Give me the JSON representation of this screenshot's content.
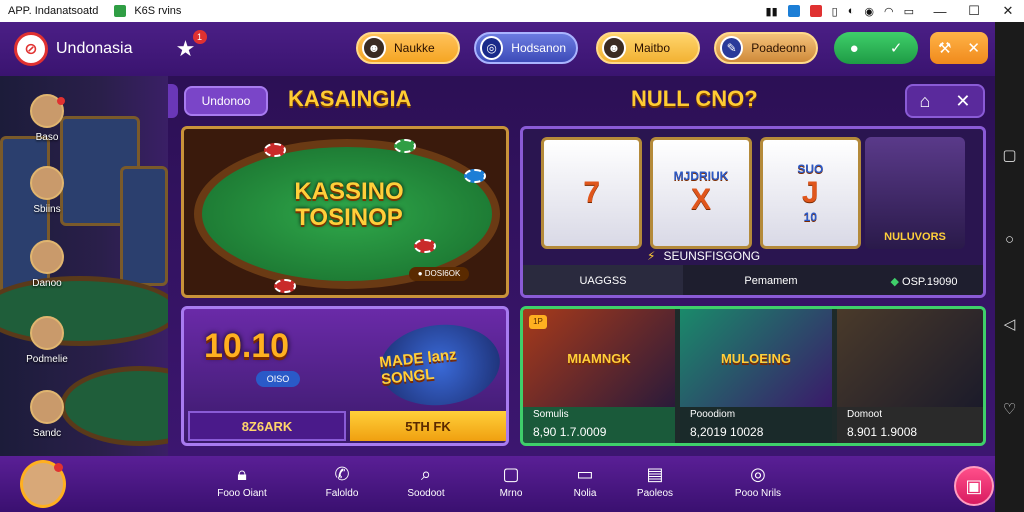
{
  "statusbar": {
    "app_title": "APP. Indanatsoatd",
    "extra_text": "K6S rvins"
  },
  "header": {
    "brand": "Undonasia",
    "notif_count": "1",
    "pills": [
      {
        "label": "Naukke"
      },
      {
        "label": "Hodsanon"
      },
      {
        "label": "Maitbo"
      },
      {
        "label": "Poadeonn"
      }
    ]
  },
  "sidebar": {
    "items": [
      {
        "label": "Baso"
      },
      {
        "label": "Sbiins"
      },
      {
        "label": "Danoo"
      },
      {
        "label": "Podmelie"
      },
      {
        "label": "Sandc"
      }
    ]
  },
  "main": {
    "tab_label": "Undonoo",
    "title_left": "KASAINGIA",
    "title_right": "NULL CNO?",
    "poker": {
      "logo": "KASSINO TOSINOP",
      "badge": "● DOSI6OK"
    },
    "slots": {
      "reels": [
        {
          "symbol": "7",
          "sub": ""
        },
        {
          "symbol": "X",
          "sub": "MJDRIUK"
        },
        {
          "symbol": "J",
          "sub": "SUO"
        },
        {
          "symbol": "",
          "sub": ""
        }
      ],
      "reel_bottom": "10",
      "hero_label": "NULUVORS",
      "caption": "SEUNSFISGONG",
      "footer_a": "UAGGSS",
      "footer_b": "Pemamem",
      "footer_c_icon": "◆",
      "footer_c": "OSP.19090"
    },
    "prize": {
      "big_number": "10.10",
      "chip_label": "OISO",
      "mega_label": "MADE lanz SONGL",
      "btn_left": "8Z6ARK",
      "btn_right": "5TH FK"
    },
    "games": [
      {
        "art": "MIAMNGK",
        "title": "Somulis",
        "value": "8,90 1.7.0009"
      },
      {
        "art": "MULOEING",
        "title": "Pooodiom",
        "value": "8,2019 10028"
      },
      {
        "art": "",
        "title": "Domoot",
        "value": "8.901 1.9008"
      }
    ],
    "hot_badge": "1P"
  },
  "bottomnav": {
    "items": [
      {
        "label": "Fooo Oiant",
        "icon": "bag-icon"
      },
      {
        "label": "Faloldo",
        "icon": "phone-icon"
      },
      {
        "label": "Soodoot",
        "icon": "search-icon"
      },
      {
        "label": "Mrno",
        "icon": "square-icon"
      },
      {
        "label": "Nolia",
        "icon": "monitor-icon"
      },
      {
        "label": "Paoleos",
        "icon": "chat-icon"
      },
      {
        "label": "Pooo Nrils",
        "icon": "target-icon"
      }
    ]
  },
  "colors": {
    "accent": "#ffcc33",
    "header_bg": "#4b1f86",
    "main_bg": "#2c1055",
    "green": "#3fcf6a",
    "pink": "#d81b60"
  }
}
